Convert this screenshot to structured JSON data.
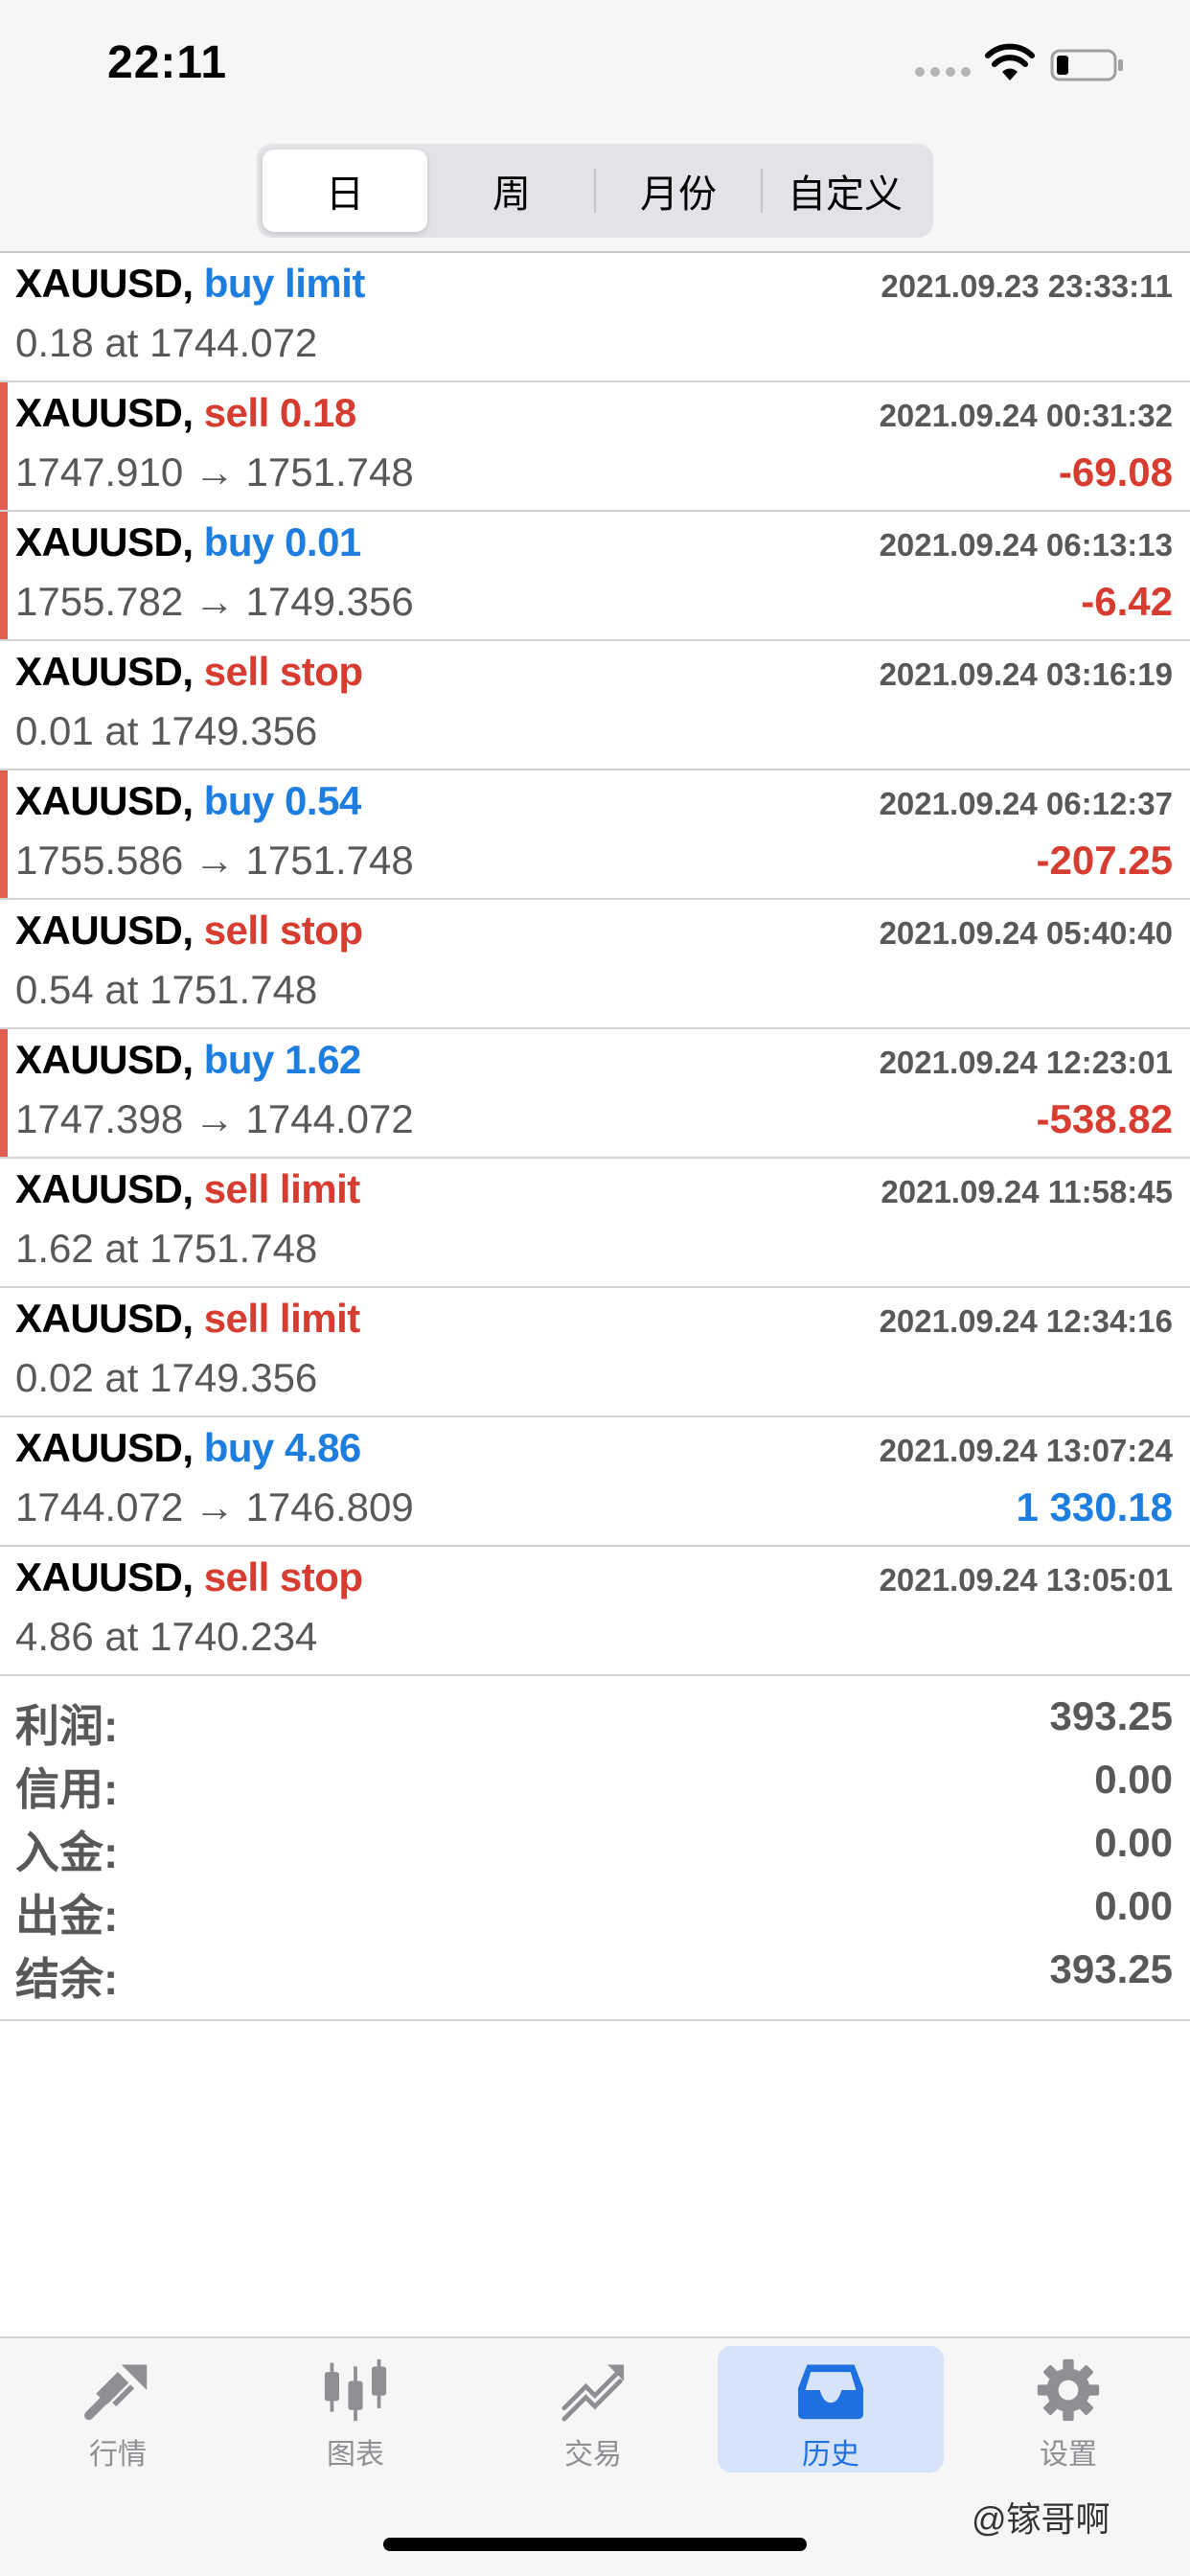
{
  "status": {
    "time": "22:11"
  },
  "segments": [
    {
      "label": "日",
      "active": true
    },
    {
      "label": "周",
      "active": false
    },
    {
      "label": "月份",
      "active": false
    },
    {
      "label": "自定义",
      "active": false
    }
  ],
  "deals": [
    {
      "symbol": "XAUUSD,",
      "action": "buy limit",
      "side": "buy",
      "detail": "0.18 at 1744.072",
      "time": "2021.09.23 23:33:11",
      "profit": "",
      "marked": false
    },
    {
      "symbol": "XAUUSD,",
      "action": "sell 0.18",
      "side": "sell",
      "detail": "1747.910 → 1751.748",
      "time": "2021.09.24 00:31:32",
      "profit": "-69.08",
      "marked": true
    },
    {
      "symbol": "XAUUSD,",
      "action": "buy 0.01",
      "side": "buy",
      "detail": "1755.782 → 1749.356",
      "time": "2021.09.24 06:13:13",
      "profit": "-6.42",
      "marked": true
    },
    {
      "symbol": "XAUUSD,",
      "action": "sell stop",
      "side": "sell",
      "detail": "0.01 at 1749.356",
      "time": "2021.09.24 03:16:19",
      "profit": "",
      "marked": false
    },
    {
      "symbol": "XAUUSD,",
      "action": "buy 0.54",
      "side": "buy",
      "detail": "1755.586 → 1751.748",
      "time": "2021.09.24 06:12:37",
      "profit": "-207.25",
      "marked": true
    },
    {
      "symbol": "XAUUSD,",
      "action": "sell stop",
      "side": "sell",
      "detail": "0.54 at 1751.748",
      "time": "2021.09.24 05:40:40",
      "profit": "",
      "marked": false
    },
    {
      "symbol": "XAUUSD,",
      "action": "buy 1.62",
      "side": "buy",
      "detail": "1747.398 → 1744.072",
      "time": "2021.09.24 12:23:01",
      "profit": "-538.82",
      "marked": true
    },
    {
      "symbol": "XAUUSD,",
      "action": "sell limit",
      "side": "sell",
      "detail": "1.62 at 1751.748",
      "time": "2021.09.24 11:58:45",
      "profit": "",
      "marked": false
    },
    {
      "symbol": "XAUUSD,",
      "action": "sell limit",
      "side": "sell",
      "detail": "0.02 at 1749.356",
      "time": "2021.09.24 12:34:16",
      "profit": "",
      "marked": false
    },
    {
      "symbol": "XAUUSD,",
      "action": "buy 4.86",
      "side": "buy",
      "detail": "1744.072 → 1746.809",
      "time": "2021.09.24 13:07:24",
      "profit": "1 330.18",
      "marked": false
    },
    {
      "symbol": "XAUUSD,",
      "action": "sell stop",
      "side": "sell",
      "detail": "4.86 at 1740.234",
      "time": "2021.09.24 13:05:01",
      "profit": "",
      "marked": false
    }
  ],
  "summary": [
    {
      "label": "利润:",
      "value": "393.25"
    },
    {
      "label": "信用:",
      "value": "0.00"
    },
    {
      "label": "入金:",
      "value": "0.00"
    },
    {
      "label": "出金:",
      "value": "0.00"
    },
    {
      "label": "结余:",
      "value": "393.25"
    }
  ],
  "tabs": [
    {
      "label": "行情",
      "icon": "quotes-icon",
      "active": false
    },
    {
      "label": "图表",
      "icon": "chart-icon",
      "active": false
    },
    {
      "label": "交易",
      "icon": "trade-icon",
      "active": false
    },
    {
      "label": "历史",
      "icon": "history-icon",
      "active": true
    },
    {
      "label": "设置",
      "icon": "settings-icon",
      "active": false
    }
  ],
  "watermark": "@镓哥啊",
  "colors": {
    "buy": "#1e7ee0",
    "sell": "#d63c2f",
    "active_tab": "#1e6fe0"
  }
}
